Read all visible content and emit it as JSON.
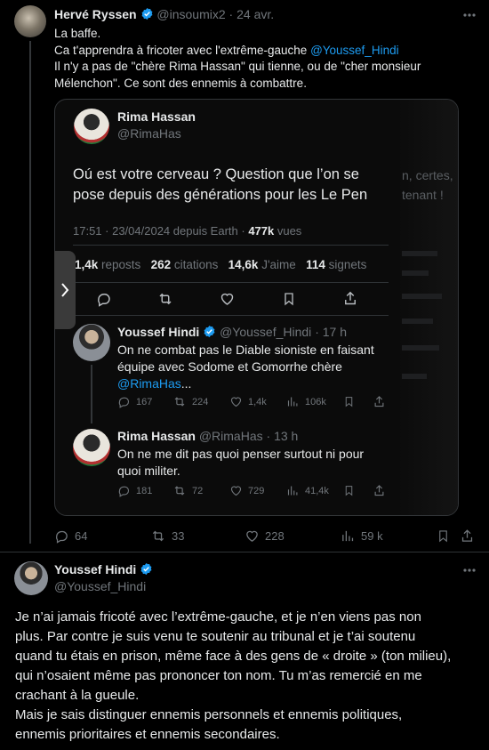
{
  "tweet1": {
    "name": "Hervé Ryssen",
    "handle": "@insoumix2",
    "sep": "·",
    "date": "24 avr.",
    "lines": [
      "La baffe.",
      "Ca t'apprendra à fricoter avec l'extrême-gauche ",
      "Il n'y a pas de \"chère Rima Hassan\" qui tienne, ou de \"cher monsieur",
      "Mélenchon\". Ce sont des ennemis à combattre."
    ],
    "mention": "@Youssef_Hindi",
    "stats": {
      "replies": "64",
      "retweets": "33",
      "likes": "228",
      "views": "59 k"
    }
  },
  "embed": {
    "name": "Rima Hassan",
    "handle": "@RimaHas",
    "text_lines": [
      "Oú est votre cerveau ? Question que l’on se",
      "pose depuis des générations pour les Le Pen"
    ],
    "time": "17:51 · 23/04/2024 depuis Earth · ",
    "views_num": "477k",
    "views_label": " vues",
    "counts": [
      {
        "num": "1,4k",
        "label": " reposts"
      },
      {
        "num": "262",
        "label": " citations"
      },
      {
        "num": "14,6k",
        "label": " J'aime"
      },
      {
        "num": "114",
        "label": " signets"
      }
    ],
    "bg_text": [
      "n, certes,",
      "tenant !"
    ]
  },
  "reply1": {
    "name": "Youssef Hindi",
    "handle": "@Youssef_Hindi",
    "sep": "·",
    "time": "17 h",
    "lines": [
      "On ne combat pas le Diable sioniste en faisant",
      "équipe avec Sodome et Gomorrhe chère"
    ],
    "mention": "@RimaHas",
    "ellipsis": "...",
    "stats": {
      "replies": "167",
      "retweets": "224",
      "likes": "1,4k",
      "views": "106k"
    }
  },
  "reply2": {
    "name": "Rima Hassan",
    "handle": "@RimaHas",
    "sep": "·",
    "time": "13 h",
    "lines": [
      "On ne me dit pas quoi penser surtout ni pour",
      "quoi militer."
    ],
    "stats": {
      "replies": "181",
      "retweets": "72",
      "likes": "729",
      "views": "41,4k"
    }
  },
  "tweet2": {
    "name": "Youssef Hindi",
    "handle": "@Youssef_Hindi",
    "lines": [
      "Je n’ai jamais fricoté avec l’extrême-gauche, et je n’en viens pas non",
      "plus. Par contre je suis venu te soutenir au tribunal et je t’ai soutenu",
      "quand tu étais en prison, même face à des gens de « droite » (ton milieu),",
      "qui n’osaient même pas prononcer ton nom. Tu m’as remercié en me",
      "crachant à la gueule.",
      "Mais je sais distinguer ennemis personnels et ennemis politiques,",
      "ennemis prioritaires et ennemis secondaires."
    ]
  },
  "colors": {
    "bg": "#000000",
    "text": "#e7e9ea",
    "muted": "#71767b",
    "link": "#1d9bf0",
    "verified": "#1d9bf0"
  },
  "icons": [
    "more-icon",
    "verified-icon",
    "reply-icon",
    "retweet-icon",
    "like-icon",
    "views-icon",
    "bookmark-icon",
    "share-icon",
    "chevron-right-icon"
  ]
}
